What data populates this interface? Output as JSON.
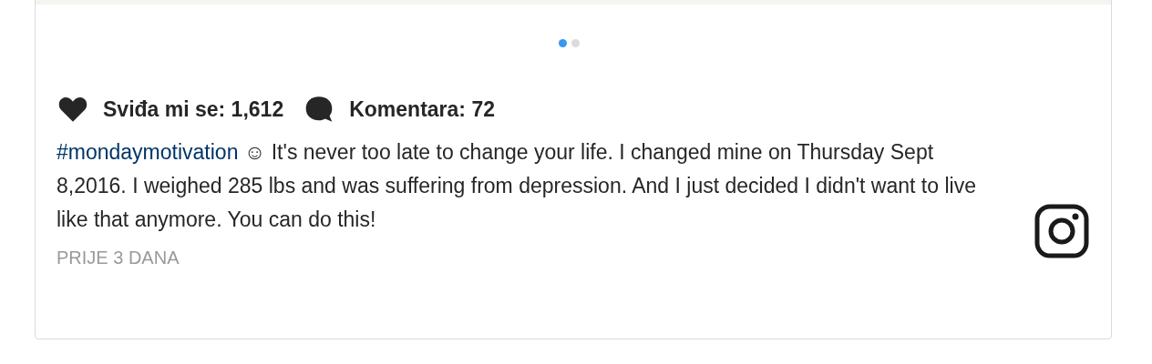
{
  "carousel": {
    "dots": [
      {
        "selected": true
      },
      {
        "selected": false
      }
    ]
  },
  "stats": {
    "likes": "Sviđa mi se: 1,612",
    "comments": "Komentara: 72"
  },
  "caption": {
    "hashtag": "#mondaymotivation",
    "text": "☺ It's never too late to change your life. I changed mine on Thursday Sept 8,2016. I weighed 285 lbs and was suffering from depression. And I just decided I didn't want to live like that anymore. You can do this!"
  },
  "time": "PRIJE 3 DANA"
}
